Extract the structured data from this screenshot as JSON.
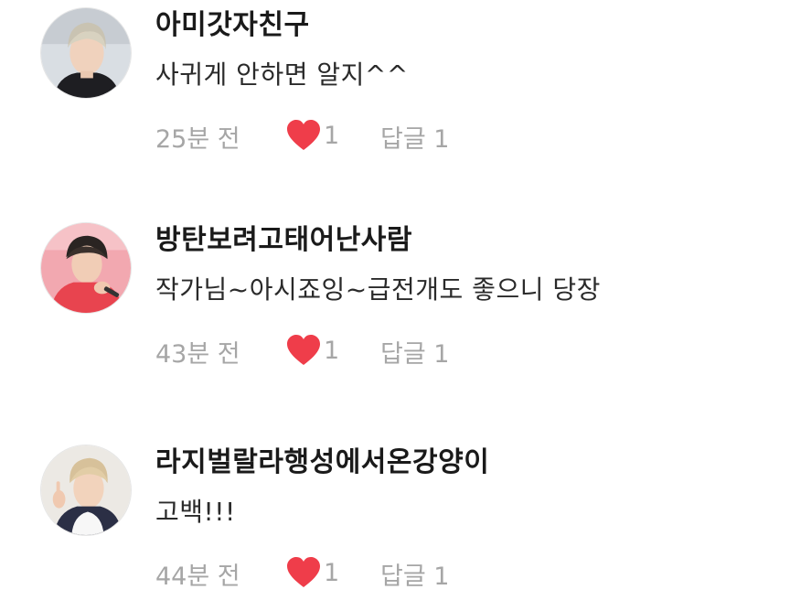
{
  "comments": [
    {
      "username": "아미갓자친구",
      "text": "사귀게 안하면 알지^^",
      "time": "25분 전",
      "likes": "1",
      "reply_label": "답글 1",
      "avatar_icon": "profile-photo"
    },
    {
      "username": "방탄보려고태어난사람",
      "text": "작가님~아시죠잉~급전개도 좋으니 당장",
      "time": "43분 전",
      "likes": "1",
      "reply_label": "답글 1",
      "avatar_icon": "profile-photo"
    },
    {
      "username": "라지벌랄라행성에서온강양이",
      "text": "고백!!!",
      "time": "44분 전",
      "likes": "1",
      "reply_label": "답글 1",
      "avatar_icon": "profile-photo"
    }
  ],
  "colors": {
    "heart": "#ef3d4a",
    "meta_text": "#a6a6a6",
    "username": "#1a1a1a"
  }
}
